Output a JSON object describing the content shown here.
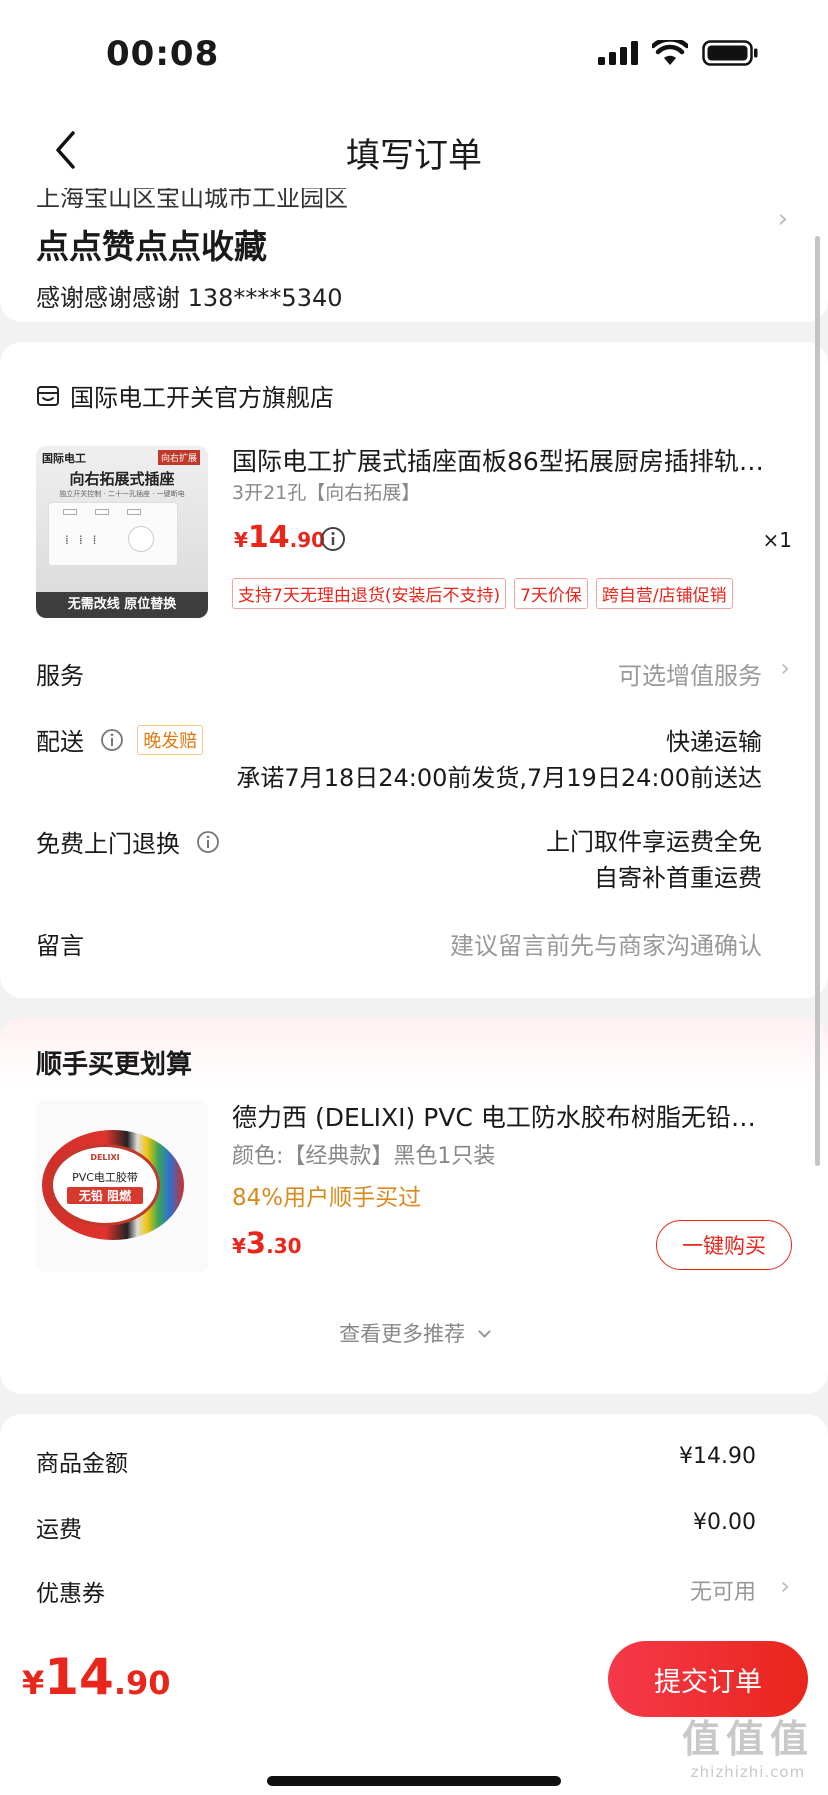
{
  "status_bar": {
    "time": "00:08"
  },
  "nav": {
    "title": "填写订单"
  },
  "address": {
    "line_cut": "上海宝山区宝山城市工业园区",
    "name": "点点赞点点收藏",
    "contact": "感谢感谢感谢  138****5340"
  },
  "store": {
    "name": "国际电工开关官方旗舰店"
  },
  "product": {
    "image_text": {
      "brand": "国际电工",
      "corner": "向右扩展",
      "headline": "向右拓展式插座",
      "sub": "独立开关控制 · 二十一孔插座 · 一键断电",
      "banner": "无需改线  原位替换"
    },
    "title": "国际电工扩展式插座面板86型拓展厨房插排轨…",
    "spec": "3开21孔【向右拓展】",
    "price_symbol": "¥",
    "price_int": "14",
    "price_dec": ".90",
    "qty": "×1",
    "tags": [
      "支持7天无理由退货(安装后不支持)",
      "7天价保",
      "跨自营/店铺促销"
    ]
  },
  "rows": {
    "service_label": "服务",
    "service_value": "可选增值服务",
    "delivery_label": "配送",
    "delivery_badge": "晚发赔",
    "delivery_method": "快递运输",
    "delivery_promise": "承诺7月18日24:00前发货,7月19日24:00前送达",
    "return_label": "免费上门退换",
    "return_line1": "上门取件享运费全免",
    "return_line2": "自寄补首重运费",
    "note_label": "留言",
    "note_placeholder": "建议留言前先与商家沟通确认"
  },
  "addon": {
    "section_title": "顺手买更划算",
    "image_text": {
      "brand": "DELIXI",
      "label": "PVC电工胶带",
      "feature": "无铅 阻燃"
    },
    "name": "德力西 (DELIXI) PVC 电工防水胶布树脂无铅…",
    "spec": "颜色:【经典款】黑色1只装",
    "promo": "84%用户顺手买过",
    "price_symbol": "¥",
    "price_int": "3",
    "price_dec": ".30",
    "buy_label": "一键购买",
    "more_label": "查看更多推荐"
  },
  "amounts": {
    "goods_label": "商品金额",
    "goods_value": "¥14.90",
    "shipping_label": "运费",
    "shipping_value": "¥0.00",
    "coupon_label": "优惠券",
    "coupon_value": "无可用"
  },
  "footer": {
    "total_symbol": "¥",
    "total_int": "14",
    "total_dec": ".90",
    "submit_label": "提交订单",
    "watermark_big": "值值值",
    "watermark_small": "zhizhizhi.com"
  },
  "colors": {
    "accent": "#e8261c",
    "promo": "#d98a1f",
    "page_bg": "#f2f2f2"
  }
}
